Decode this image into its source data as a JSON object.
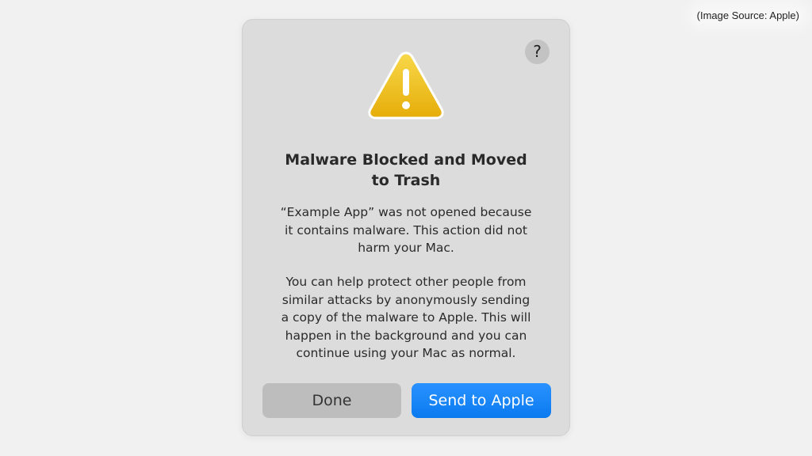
{
  "source_note": "(Image Source: Apple)",
  "dialog": {
    "help_label": "?",
    "icon": "warning-triangle-icon",
    "title_line_1": "Malware Blocked and Moved",
    "title_line_2": "to Trash",
    "message_1_lines": [
      "“Example App” was not opened because",
      "it contains malware. This action did not",
      "harm your Mac."
    ],
    "message_2_lines": [
      "You can help protect other people from",
      "similar attacks by anonymously sending",
      "a copy of the malware to Apple. This will",
      "happen in the background and you can",
      "continue using your Mac as normal."
    ],
    "buttons": {
      "done": "Done",
      "send": "Send to Apple"
    }
  },
  "colors": {
    "accent": "#0a7af0",
    "warning_yellow": "#f2c31a",
    "dialog_bg": "#dcdcdc"
  }
}
